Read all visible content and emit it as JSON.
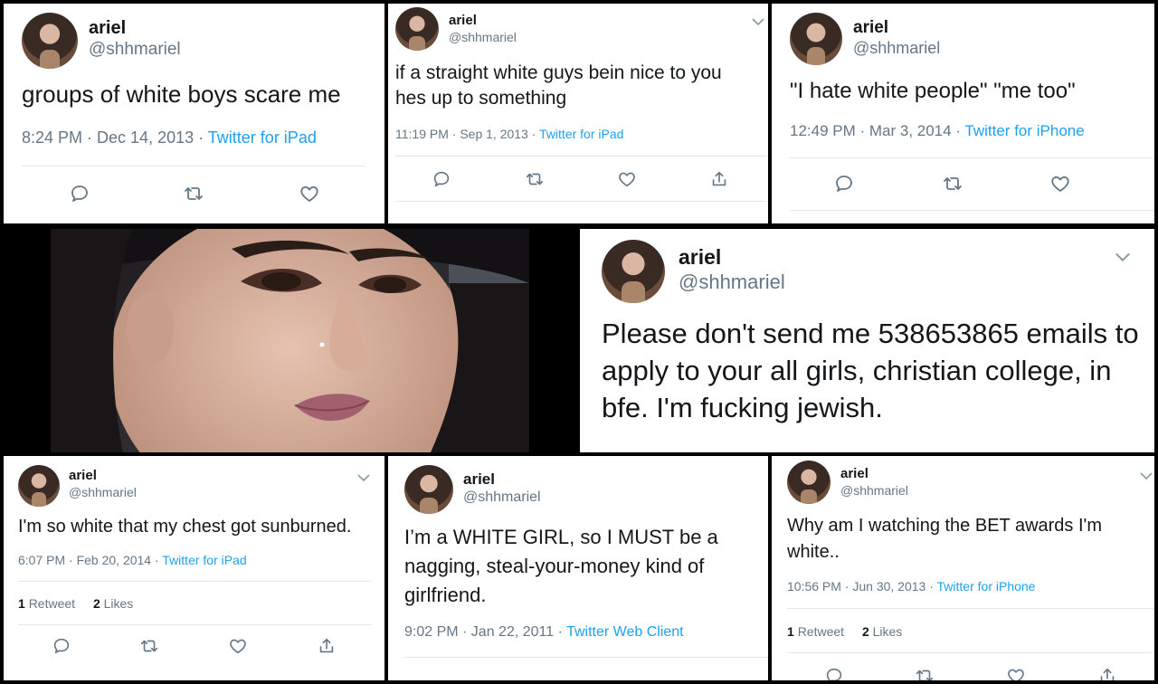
{
  "tweets": [
    {
      "name": "ariel",
      "handle": "@shhmariel",
      "text": "groups of white boys scare me",
      "time": "8:24 PM · Dec 14, 2013",
      "source": "Twitter for iPad"
    },
    {
      "name": "ariel",
      "handle": "@shhmariel",
      "text": "if a straight white guys bein nice to you hes up to something",
      "time": "11:19 PM · Sep 1, 2013",
      "source": "Twitter for iPad"
    },
    {
      "name": "ariel",
      "handle": "@shhmariel",
      "text": "\"I hate white people\" \"me too\"",
      "time": "12:49 PM · Mar 3, 2014",
      "source": "Twitter for iPhone"
    },
    {
      "name": "ariel",
      "handle": "@shhmariel",
      "text": "Please don't send me 538653865 emails to apply to your all girls, christian college, in bfe. I'm fucking jewish."
    },
    {
      "name": "ariel",
      "handle": "@shhmariel",
      "text": "I'm so white that my chest got sunburned.",
      "time": "6:07 PM · Feb 20, 2014",
      "source": "Twitter for iPad",
      "retweets": "1",
      "retweets_label": "Retweet",
      "likes": "2",
      "likes_label": "Likes"
    },
    {
      "name": "ariel",
      "handle": "@shhmariel",
      "text": "I’m a WHITE GIRL, so I MUST be a nagging, steal-your-money kind of girlfriend.",
      "time": "9:02 PM · Jan 22, 2011",
      "source": "Twitter Web Client"
    },
    {
      "name": "ariel",
      "handle": "@shhmariel",
      "text": "Why am I watching the BET awards I'm white..",
      "time": "10:56 PM · Jun 30, 2013",
      "source": "Twitter for iPhone",
      "retweets": "1",
      "retweets_label": "Retweet",
      "likes": "2",
      "likes_label": "Likes"
    }
  ],
  "colors": {
    "link": "#1da1f2",
    "secondary_text": "#657786",
    "divider": "#e1e8ed",
    "background": "#000000"
  },
  "icons": [
    "reply-icon",
    "retweet-icon",
    "like-icon",
    "share-icon",
    "chevron-down-icon"
  ]
}
